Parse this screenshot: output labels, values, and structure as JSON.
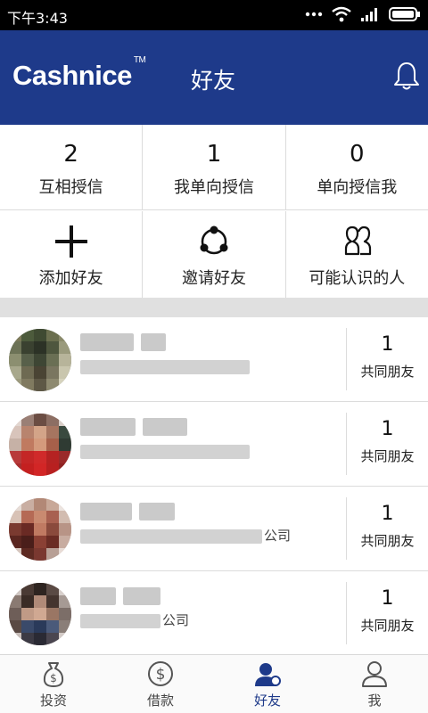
{
  "status_bar": {
    "time": "下午3:43"
  },
  "app_bar": {
    "logo": "Cashnice",
    "trademark": "TM",
    "title": "好友",
    "notification_icon": "bell-icon"
  },
  "stats": [
    {
      "count": "2",
      "label": "互相授信"
    },
    {
      "count": "1",
      "label": "我单向授信"
    },
    {
      "count": "0",
      "label": "单向授信我"
    }
  ],
  "actions": [
    {
      "icon": "plus-icon",
      "label": "添加好友"
    },
    {
      "icon": "share-icon",
      "label": "邀请好友"
    },
    {
      "icon": "people-icon",
      "label": "可能认识的人"
    }
  ],
  "friends": [
    {
      "company": "",
      "mutual_count": "1",
      "mutual_label": "共同朋友"
    },
    {
      "company": "",
      "mutual_count": "1",
      "mutual_label": "共同朋友"
    },
    {
      "company": "公司",
      "mutual_count": "1",
      "mutual_label": "共同朋友"
    },
    {
      "company": "公司",
      "mutual_count": "1",
      "mutual_label": "共同朋友"
    }
  ],
  "tabs": [
    {
      "icon": "money-bag-icon",
      "label": "投资",
      "active": false
    },
    {
      "icon": "dollar-coin-icon",
      "label": "借款",
      "active": false
    },
    {
      "icon": "friends-icon",
      "label": "好友",
      "active": true
    },
    {
      "icon": "user-icon",
      "label": "我",
      "active": false
    }
  ],
  "colors": {
    "primary": "#1e3a8a",
    "divider": "#e0e0e0"
  }
}
